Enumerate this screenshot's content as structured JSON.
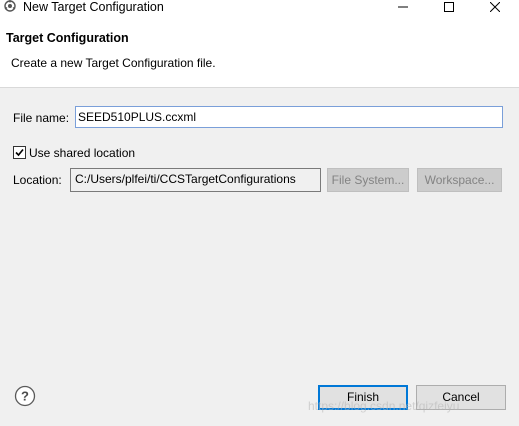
{
  "window": {
    "title": "New Target Configuration"
  },
  "banner": {
    "title": "Target Configuration",
    "description": "Create a new Target Configuration file."
  },
  "form": {
    "file_name_label": "File name:",
    "file_name_value": "SEED510PLUS.ccxml",
    "shared_location_label": "Use shared location",
    "shared_location_checked": true,
    "location_label": "Location:",
    "location_value": "C:/Users/plfei/ti/CCSTargetConfigurations",
    "file_system_button": "File System...",
    "workspace_button": "Workspace..."
  },
  "footer": {
    "finish_button": "Finish",
    "cancel_button": "Cancel",
    "watermark": "https://blog.csdn.net/qizfeiyu"
  },
  "icons": {
    "app": "eclipse-gear-icon",
    "help": "help-question-icon",
    "check": "checkmark-icon"
  },
  "colors": {
    "accent": "#0078d7",
    "background": "#f0f0f0"
  }
}
